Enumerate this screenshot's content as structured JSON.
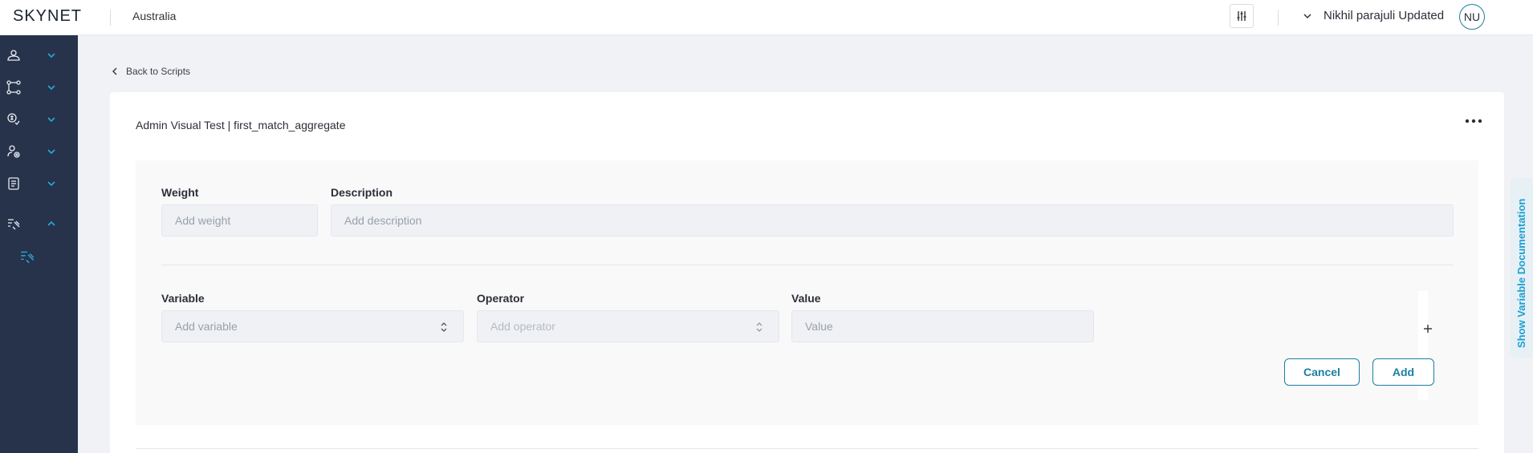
{
  "app": {
    "logo": "SKYNET",
    "region": "Australia"
  },
  "user": {
    "name": "Nikhil parajuli Updated",
    "initials": "NU"
  },
  "sidebar": {
    "items": [
      {
        "icon": "users-icon"
      },
      {
        "icon": "flow-icon"
      },
      {
        "icon": "payments-icon"
      },
      {
        "icon": "risk-settings-icon"
      },
      {
        "icon": "document-icon"
      },
      {
        "icon": "scripts-icon",
        "expanded": true
      }
    ],
    "sub_item_icon": "scripts-sub-icon"
  },
  "nav": {
    "back_label": "Back to Scripts"
  },
  "card": {
    "title": "Admin Visual Test | first_match_aggregate"
  },
  "form": {
    "weight": {
      "label": "Weight",
      "placeholder": "Add weight"
    },
    "description": {
      "label": "Description",
      "placeholder": "Add description"
    },
    "variable": {
      "label": "Variable",
      "placeholder": "Add variable"
    },
    "operator": {
      "label": "Operator",
      "placeholder": "Add operator"
    },
    "value": {
      "label": "Value",
      "placeholder": "Value"
    }
  },
  "actions": {
    "cancel": "Cancel",
    "add": "Add"
  },
  "side_tab": {
    "label": "Show Variable Documentation"
  },
  "colors": {
    "sidebar": "#26334a",
    "accent": "#1a7fa0",
    "link": "#1a9fd0"
  }
}
